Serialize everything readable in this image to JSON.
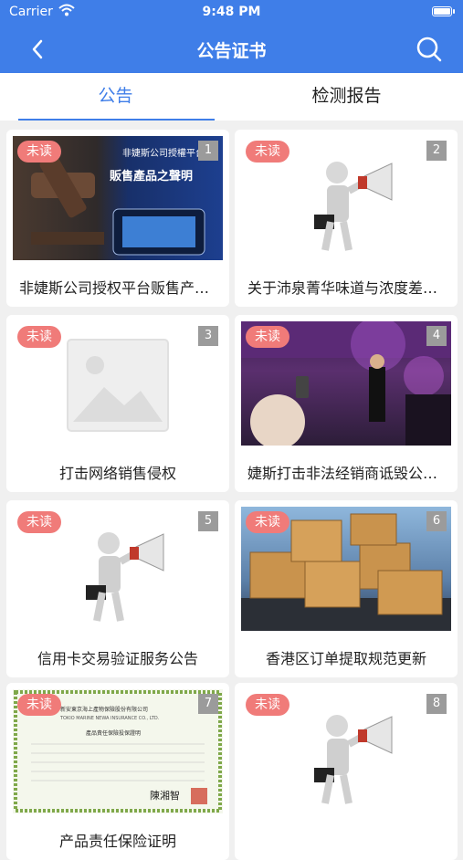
{
  "status_bar": {
    "carrier": "Carrier",
    "time": "9:48 PM"
  },
  "navbar": {
    "title": "公告证书",
    "back_icon": "chevron-left-icon",
    "search_icon": "search-icon"
  },
  "tabs": [
    {
      "label": "公告",
      "active": true
    },
    {
      "label": "检测报告",
      "active": false
    }
  ],
  "cards": [
    {
      "badge": "未读",
      "number": "1",
      "caption": "非婕斯公司授权平台贩售产品之声明",
      "image": "gavel-banner",
      "image_text": [
        "非婕斯公司授權平台",
        "販售產品之聲明"
      ]
    },
    {
      "badge": "未读",
      "number": "2",
      "caption": "关于沛泉菁华味道与浓度差异的说明",
      "image": "megaphone-figure"
    },
    {
      "badge": "未读",
      "number": "3",
      "caption": "打击网络销售侵权",
      "image": "image-placeholder"
    },
    {
      "badge": "未读",
      "number": "4",
      "caption": "婕斯打击非法经销商诋毁公司名誉",
      "image": "concert-photo"
    },
    {
      "badge": "未读",
      "number": "5",
      "caption": "信用卡交易验证服务公告",
      "image": "megaphone-figure"
    },
    {
      "badge": "未读",
      "number": "6",
      "caption": "香港区订单提取规范更新",
      "image": "boxes-photo"
    },
    {
      "badge": "未读",
      "number": "7",
      "caption": "产品责任保险证明",
      "image": "certificate",
      "image_text": [
        "新安東京海上產物保險股份有限公司",
        "TOKIO MARINE NEWA INSURANCE CO., LTD.",
        "產品責任保險投保證明",
        "陳湘智"
      ]
    },
    {
      "badge": "未读",
      "number": "8",
      "caption": "",
      "image": "megaphone-figure"
    }
  ],
  "colors": {
    "primary": "#3f7ee8",
    "badge": "#f07b79",
    "number_bg": "#9b9b9b"
  }
}
